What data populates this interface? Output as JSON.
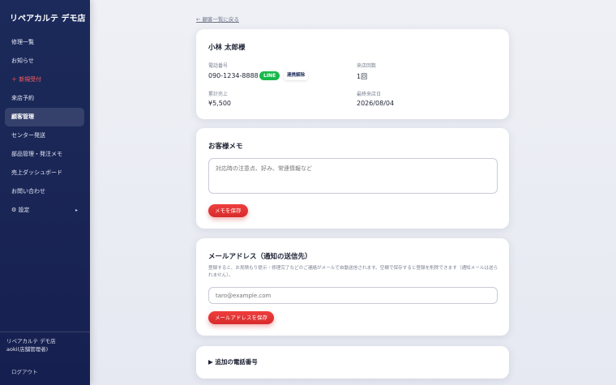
{
  "sidebar": {
    "brand": "リペアカルテ デモ店",
    "items": [
      {
        "label": "修理一覧"
      },
      {
        "label": "お知らせ"
      },
      {
        "label": "＋ 新規受付"
      },
      {
        "label": "来店予約"
      },
      {
        "label": "顧客管理"
      },
      {
        "label": "センター発送"
      },
      {
        "label": "部品管理・発注メモ"
      },
      {
        "label": "売上ダッシュボード"
      },
      {
        "label": "お問い合わせ"
      },
      {
        "label": "⚙ 設定",
        "caret": "▸"
      }
    ],
    "store_name": "リペアカルテ デモ店",
    "user": "aoki(店舗管理者)",
    "logout": "ログアウト"
  },
  "back_link": "← 顧客一覧に戻る",
  "customer": {
    "name": "小林 太郎様",
    "phone_label": "電話番号",
    "phone": "090-1234-8888",
    "line_badge": "LINE",
    "unlink_button": "連携解除",
    "visits_label": "来店回数",
    "visits": "1回",
    "sales_label": "累計売上",
    "sales": "¥5,500",
    "last_visit_label": "最終来店日",
    "last_visit": "2026/08/04"
  },
  "memo": {
    "title": "お客様メモ",
    "placeholder": "対応時の注意点、好み、常連情報など",
    "save_button": "メモを保存"
  },
  "email": {
    "title": "メールアドレス（通知の送信先）",
    "description": "登録すると、お見積もり提示・修理完了などのご連絡がメールで自動送信されます。空欄で保存すると登録を削除できます（通知メールは送られません）。",
    "placeholder": "taro@example.com",
    "save_button": "メールアドレスを保存"
  },
  "extra_phone": {
    "title": "▶ 追加の電話番号"
  },
  "colors": {
    "sidebar": "#1b2a5a",
    "accent_red": "#e03434",
    "line_green": "#18b84a"
  }
}
